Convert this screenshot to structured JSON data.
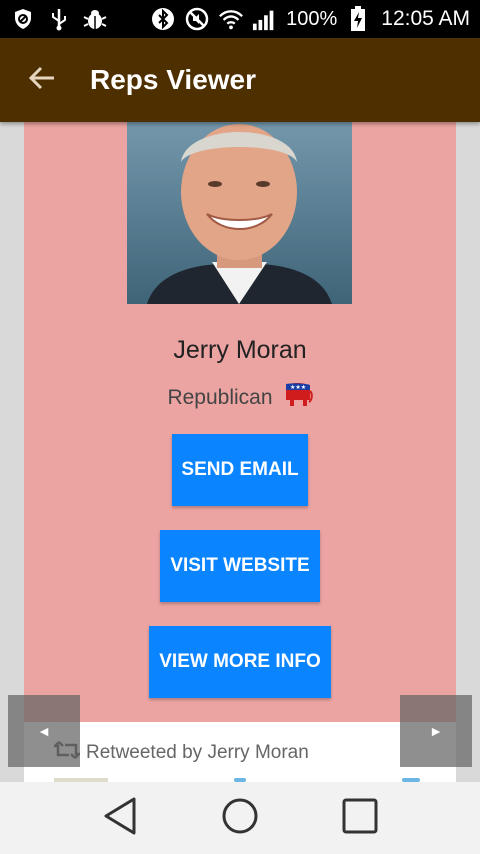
{
  "status_bar": {
    "battery": "100%",
    "time": "12:05 AM"
  },
  "app_bar": {
    "title": "Reps Viewer"
  },
  "rep": {
    "name": "Jerry Moran",
    "party": "Republican",
    "party_icon": "republican-elephant-icon"
  },
  "buttons": {
    "email": "SEND EMAIL",
    "website": "VISIT WEBSITE",
    "info": "VIEW MORE INFO"
  },
  "tweet": {
    "retweet_label": "Retweeted by Jerry Moran"
  },
  "pager": {
    "prev": "◄",
    "next": "►"
  },
  "colors": {
    "app_bar": "#4d2f00",
    "card_background": "#eca4a2",
    "button": "#0a84ff"
  }
}
